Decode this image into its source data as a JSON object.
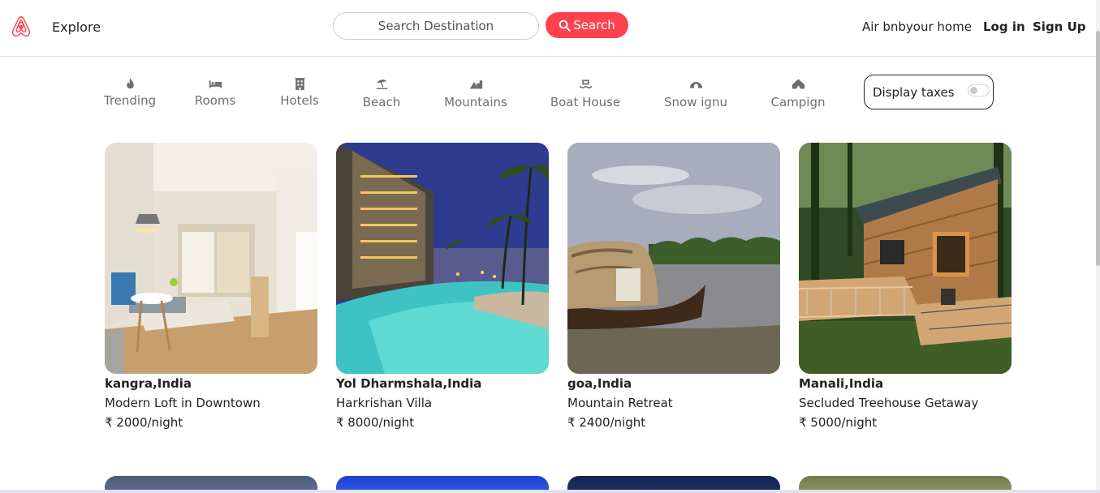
{
  "nav": {
    "explore": "Explore",
    "search_placeholder": "Search Destination",
    "search_button": "Search",
    "host": "Air bnbyour home",
    "login": "Log in",
    "signup": "Sign Up"
  },
  "filters": [
    {
      "label": "Trending",
      "icon": "fire-icon"
    },
    {
      "label": "Rooms",
      "icon": "bed-icon"
    },
    {
      "label": "Hotels",
      "icon": "hotel-icon"
    },
    {
      "label": "Beach",
      "icon": "umbrella-beach-icon"
    },
    {
      "label": "Mountains",
      "icon": "mountain-city-icon"
    },
    {
      "label": "Boat House",
      "icon": "water-ladder-icon"
    },
    {
      "label": "Snow ignu",
      "icon": "igloo-icon"
    },
    {
      "label": "Campign",
      "icon": "campground-icon"
    }
  ],
  "tax_toggle": {
    "label": "Display taxes",
    "on": false
  },
  "listings": [
    {
      "location": "kangra,India",
      "title": "Modern Loft in Downtown",
      "price": "₹ 2000/night",
      "image": "hotel room"
    },
    {
      "location": "Yol Dharmshala,India",
      "title": "Harkrishan Villa",
      "price": "₹ 8000/night",
      "image": "resort pool"
    },
    {
      "location": "goa,India",
      "title": "Mountain Retreat",
      "price": "₹ 2400/night",
      "image": "houseboat"
    },
    {
      "location": "Manali,India",
      "title": "Secluded Treehouse Getaway",
      "price": "₹ 5000/night",
      "image": "treehouse"
    }
  ],
  "colors": {
    "brand": "#fe424d",
    "text": "#222222",
    "muted": "#6f6f6f"
  }
}
